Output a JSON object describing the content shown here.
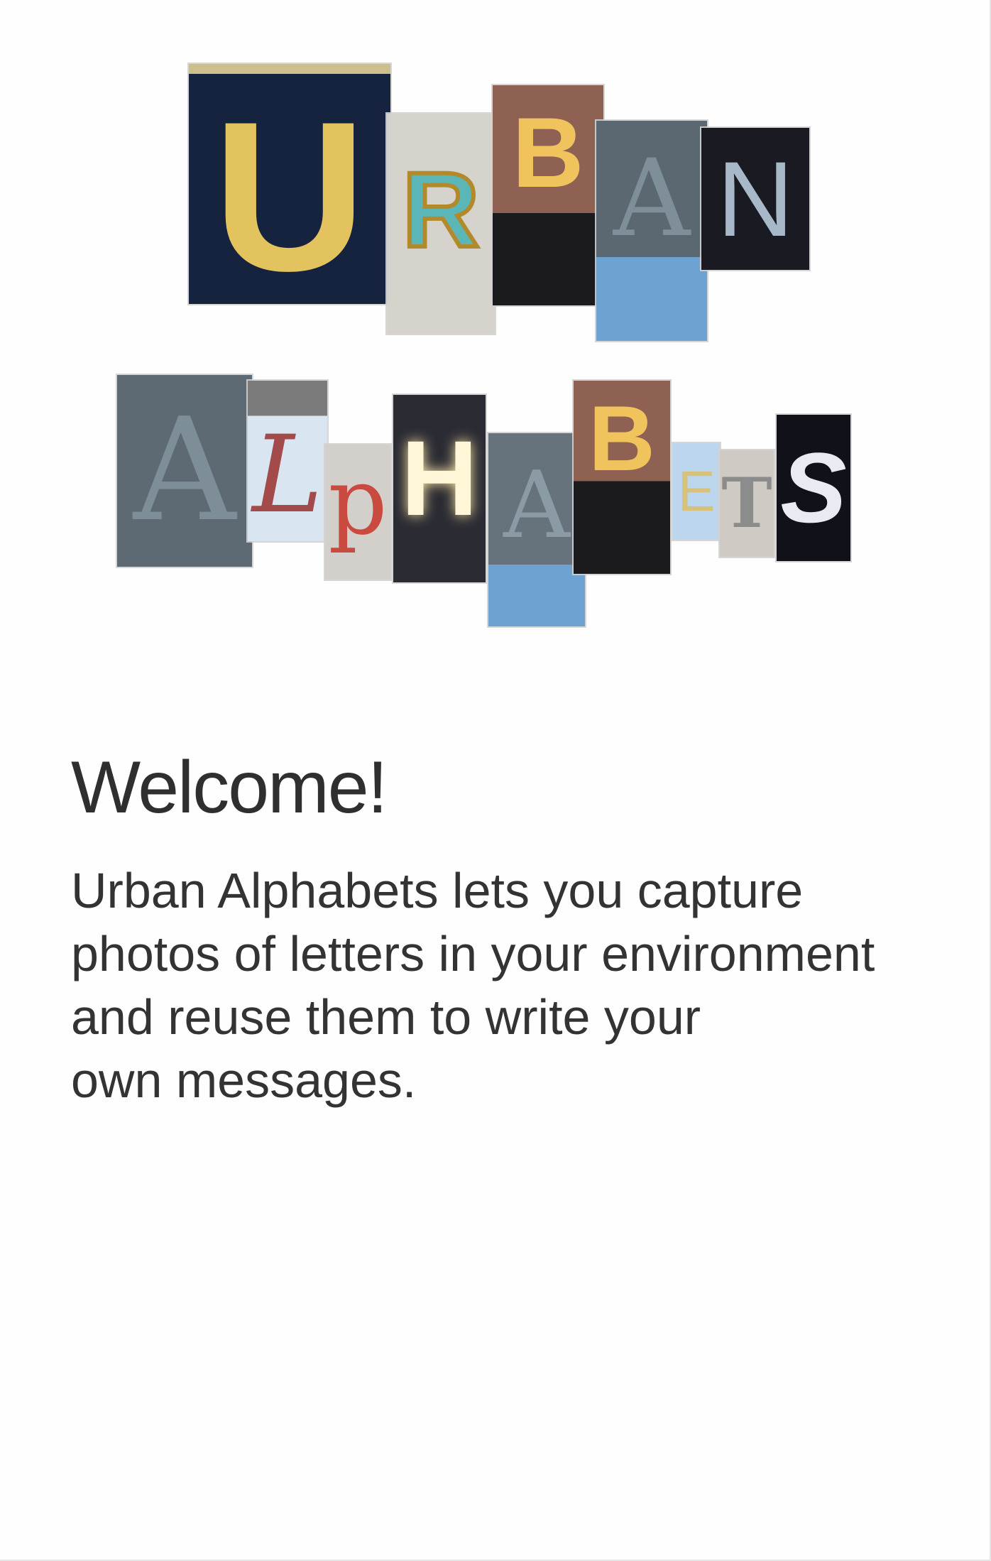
{
  "logo": {
    "alt_name": "Urban Alphabets",
    "row1": [
      {
        "letter": "U",
        "bg": "#16233f",
        "fg": "#e3c35e"
      },
      {
        "letter": "R",
        "bg": "#d6d3cd",
        "fg": "#5bb7b7"
      },
      {
        "letter": "B",
        "bg": "#8f6153",
        "fg": "#f1c35d"
      },
      {
        "letter": "A",
        "bg": "#5b6771",
        "fg": "#7f8f9a"
      },
      {
        "letter": "N",
        "bg": "#1a1b22",
        "fg": "#a7b9c9"
      }
    ],
    "row2": [
      {
        "letter": "A",
        "bg": "#5e6a73",
        "fg": "#7e8e99"
      },
      {
        "letter": "L",
        "bg": "#d9e6f2",
        "fg": "#a34a4a"
      },
      {
        "letter": "p",
        "bg": "#d3d0cb",
        "fg": "#c94a3f"
      },
      {
        "letter": "H",
        "bg": "#2b2b33",
        "fg": "#fff6d8"
      },
      {
        "letter": "A",
        "bg": "#66737c",
        "fg": "#8b9ba6"
      },
      {
        "letter": "B",
        "bg": "#8f6153",
        "fg": "#f1c35d"
      },
      {
        "letter": "E",
        "bg": "#bcd6ee",
        "fg": "#d8c27a"
      },
      {
        "letter": "T",
        "bg": "#cfcbc4",
        "fg": "#8c8c8c"
      },
      {
        "letter": "S",
        "bg": "#111219",
        "fg": "#e8ecf2"
      }
    ]
  },
  "content": {
    "title": "Welcome!",
    "body": "Urban Alphabets lets you capture\nphotos of letters in your environment\nand reuse them to write your\nown messages."
  }
}
